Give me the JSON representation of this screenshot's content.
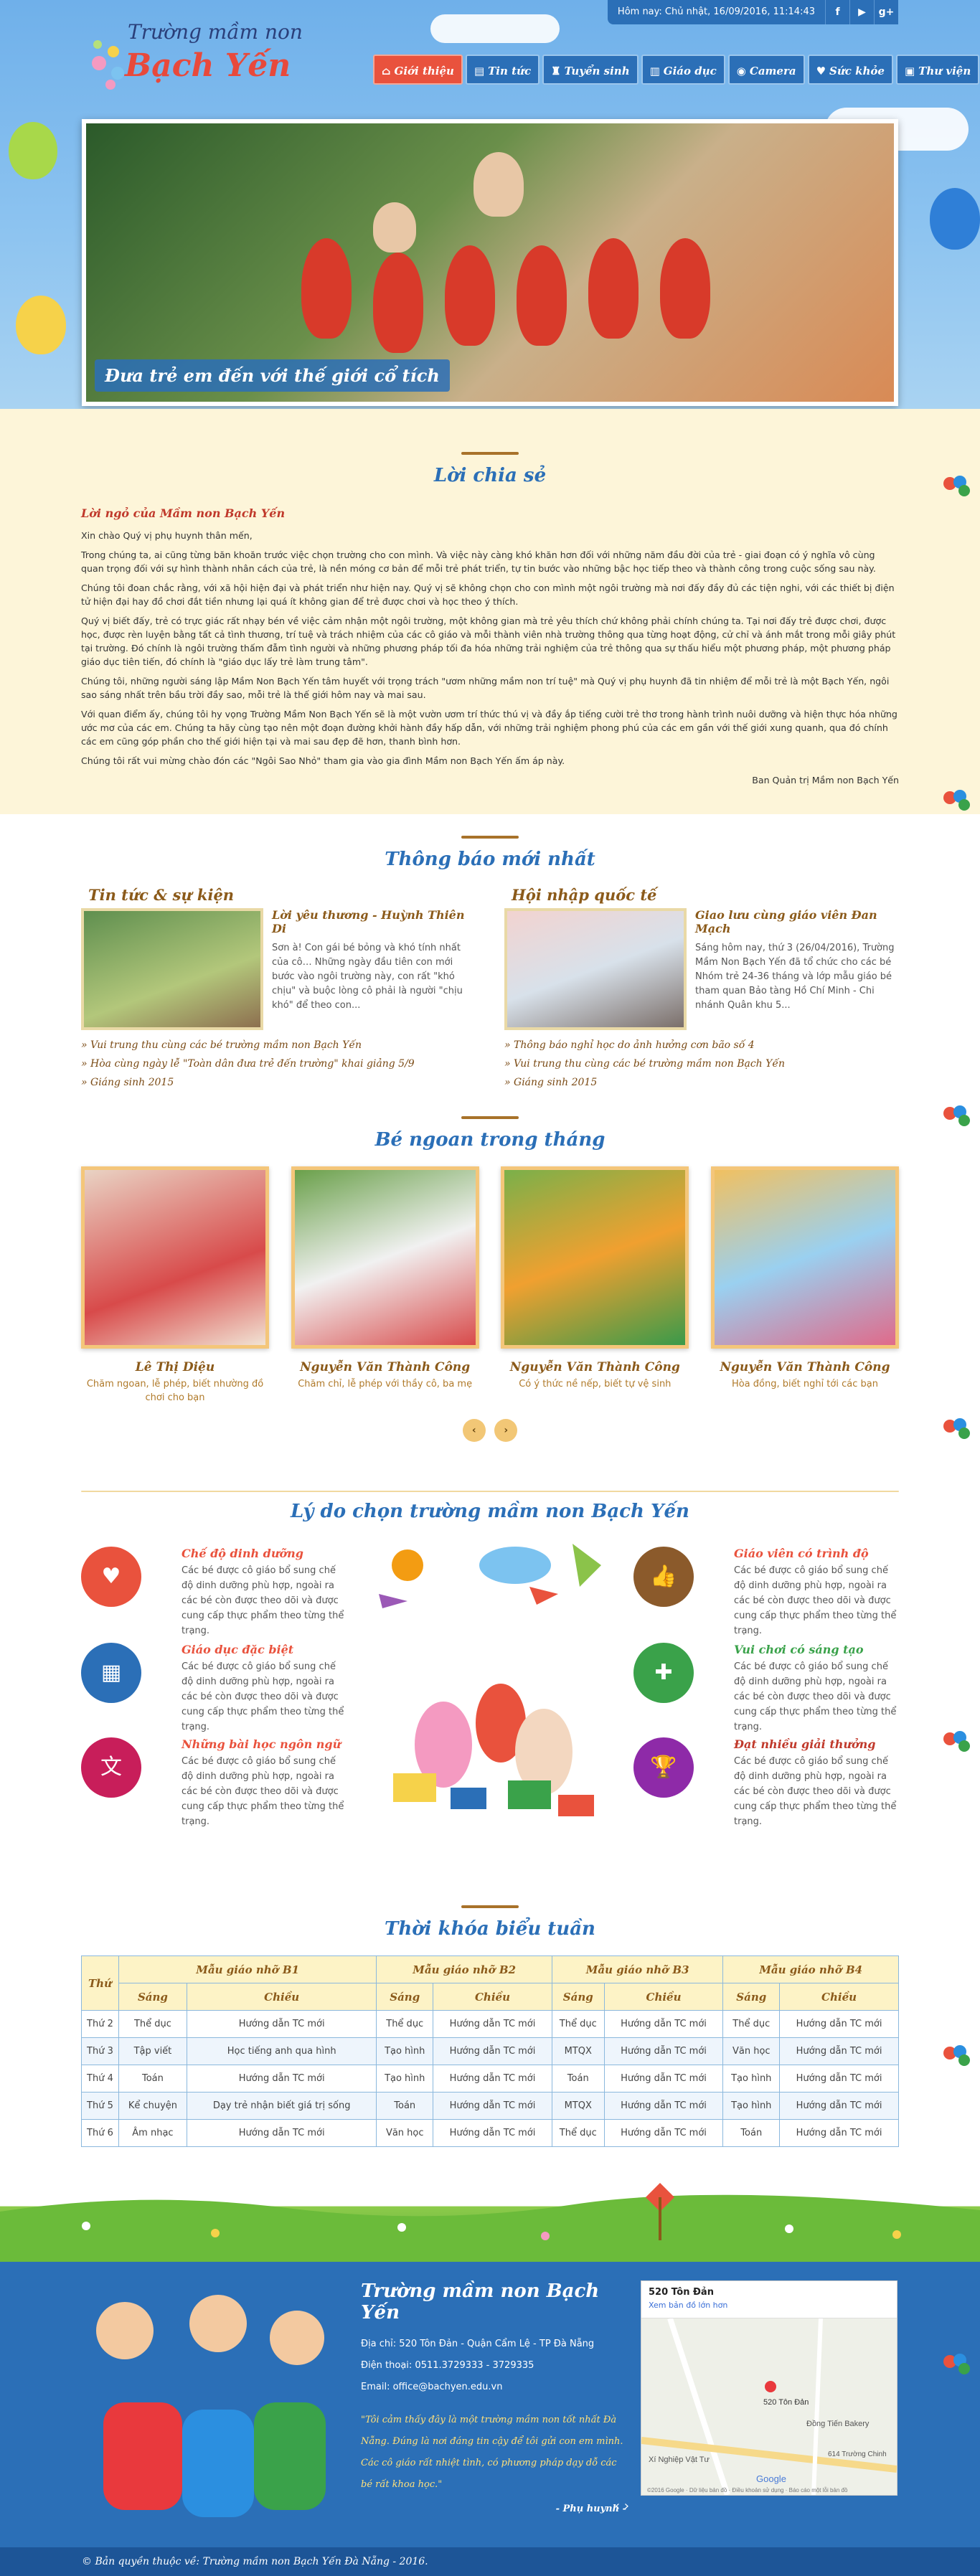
{
  "header": {
    "date_text": "Hôm nay: Chủ nhật, 16/09/2016, 11:14:43",
    "social": [
      "f",
      "▶",
      "g+"
    ],
    "logo_line1": "Trường mầm non",
    "logo_line2": "Bạch Yến",
    "nav": [
      {
        "label": "Giới thiệu",
        "icon": "home-icon",
        "glyph": "⌂"
      },
      {
        "label": "Tin tức",
        "icon": "news-icon",
        "glyph": "▤"
      },
      {
        "label": "Tuyển sinh",
        "icon": "graduation-icon",
        "glyph": "♜"
      },
      {
        "label": "Giáo dục",
        "icon": "book-icon",
        "glyph": "▥"
      },
      {
        "label": "Camera",
        "icon": "camera-icon",
        "glyph": "◉"
      },
      {
        "label": "Sức khỏe",
        "icon": "heart-icon",
        "glyph": "♥"
      },
      {
        "label": "Thư viện",
        "icon": "image-icon",
        "glyph": "▣"
      }
    ],
    "slider_caption": "Đưa trẻ em đến với thế giới cổ tích"
  },
  "about": {
    "title": "Lời chia sẻ",
    "lead": "Lời ngỏ của Mầm non Bạch Yến",
    "paragraphs": [
      "Xin chào Quý vị phụ huynh thân mến,",
      "Trong chúng ta, ai cũng từng băn khoăn trước việc chọn trường cho con mình. Và việc này càng khó khăn hơn đối với những năm đầu đời của trẻ - giai đoạn có ý nghĩa vô cùng quan trọng đối với sự hình thành nhân cách của trẻ, là nền móng cơ bản để mỗi trẻ phát triển, tự tin bước vào những bậc học tiếp theo và thành công trong cuộc sống sau này.",
      "Chúng tôi đoan chắc rằng, với xã hội hiện đại và phát triển như hiện nay. Quý vị sẽ không chọn cho con mình một ngôi trường mà nơi đấy đầy đủ các tiện nghi, với các thiết bị điện tử hiện đại hay đồ chơi đắt tiền nhưng lại quá ít không gian để trẻ được chơi và học theo ý thích.",
      "Quý vị biết đấy, trẻ có trực giác rất nhạy bén về việc cảm nhận một ngôi trường, một không gian mà trẻ yêu thích chứ không phải chính chúng ta. Tại nơi đấy trẻ được chơi, được học, được rèn luyện bằng tất cả tình thương, trí tuệ và trách nhiệm của các cô giáo và mỗi thành viên nhà trường thông qua từng hoạt động, cử chỉ và ánh mắt trong mỗi giây phút tại trường. Đó chính là ngôi trường thấm đẫm tình người và những phương pháp tối đa hóa những trải nghiệm của trẻ thông qua sự thấu hiểu một phương pháp, một phương pháp giáo dục tiên tiến, đó chính là \"giáo dục lấy trẻ làm trung tâm\".",
      "Chúng tôi, những người sáng lập Mầm Non Bạch Yến tâm huyết với trọng trách \"ươm những mầm non trí tuệ\" mà Quý vị phụ huynh đã tin nhiệm để mỗi trẻ là một Bạch Yến, ngôi sao sáng nhất trên bầu trời đầy sao, mỗi trẻ là thế giới hôm nay và mai sau.",
      "Với quan điểm ấy, chúng tôi hy vọng Trường Mầm Non Bạch Yến sẽ là một vườn ươm trí thức thú vị và đầy ắp tiếng cười trẻ thơ trong hành trình nuôi dưỡng và hiện thực hóa những ước mơ của các em. Chúng ta hãy cùng tạo nên một đoạn đường khởi hành đầy hấp dẫn, với những trải nghiệm phong phú của các em gần với thế giới xung quanh, qua đó chính các em cũng góp phần cho thế giới hiện tại và mai sau đẹp đẽ hơn, thanh bình hơn.",
      "Chúng tôi rất vui mừng chào đón các \"Ngôi Sao Nhỏ\" tham gia vào gia đình Mầm non Bạch Yến ấm áp này."
    ],
    "signature": "Ban Quản trị Mầm non Bạch Yến"
  },
  "news": {
    "title": "Thông báo mới nhất",
    "columns": [
      {
        "heading": "Tin tức & sự kiện",
        "item_title": "Lời yêu thương - Huỳnh Thiên Di",
        "item_desc": "Sơn à! Con gái bé bỏng và khó tính nhất của cô… Những ngày đầu tiên con mới bước vào ngôi trường này, con rất \"khó chịu\" và buộc lòng cô phải là người \"chịu khó\" để theo con...",
        "links": [
          "» Vui trung thu cùng các bé trường mầm non Bạch Yến",
          "» Hòa cùng ngày lễ \"Toàn dân đưa trẻ đến trường\" khai giảng 5/9",
          "» Giáng sinh 2015"
        ]
      },
      {
        "heading": "Hội nhập quốc tế",
        "item_title": "Giao lưu cùng giáo viên Đan Mạch",
        "item_desc": "Sáng hôm nay, thứ 3 (26/04/2016), Trường Mầm Non Bạch Yến đã tổ chức cho các bé Nhóm trẻ 24-36 tháng và lớp mẫu giáo bé tham quan Bảo tàng Hồ Chí Minh - Chi nhánh Quân khu 5...",
        "links": [
          "» Thông báo nghỉ học do ảnh hưởng cơn bão số 4",
          "» Vui trung thu cùng các bé trường mầm non Bạch Yến",
          "» Giáng sinh 2015"
        ]
      }
    ]
  },
  "kids": {
    "title": "Bé ngoan trong tháng",
    "cards": [
      {
        "name": "Lê Thị Diệu",
        "desc": "Chăm ngoan, lễ phép, biết nhường đồ chơi cho bạn"
      },
      {
        "name": "Nguyễn Văn Thành Công",
        "desc": "Chăm chỉ, lễ phép với thầy cô, ba mẹ"
      },
      {
        "name": "Nguyễn Văn Thành Công",
        "desc": "Có ý thức nề nếp, biết tự vệ sinh"
      },
      {
        "name": "Nguyễn Văn Thành Công",
        "desc": "Hòa đồng, biết nghỉ tới các bạn"
      }
    ],
    "prev": "‹",
    "next": "›"
  },
  "reasons": {
    "title": "Lý do chọn trường mầm non Bạch Yến",
    "desc": "Các bé được cô giáo bổ sung chế độ dinh dưỡng phù hợp, ngoài ra các bé còn được theo dõi và được cung cấp thực phẩm theo từng thể trạng.",
    "left": [
      {
        "title": "Chế độ dinh dưỡng",
        "icon": "heart-icon",
        "glyph": "♥",
        "color": "#e9523d"
      },
      {
        "title": "Giáo dục đặc biệt",
        "icon": "calendar-icon",
        "glyph": "▦",
        "color": "#2b6fb7"
      },
      {
        "title": "Những bài học ngôn ngữ",
        "icon": "translate-icon",
        "glyph": "文",
        "color": "#c81e5a"
      }
    ],
    "right": [
      {
        "title": "Giáo viên có trình độ",
        "icon": "thumbs-up-icon",
        "glyph": "👍",
        "color": "#8b5a2b"
      },
      {
        "title": "Vui chơi có sáng tạo",
        "icon": "gamepad-icon",
        "glyph": "✚",
        "color": "#3aa24a"
      },
      {
        "title": "Đạt nhiều giải thưởng",
        "icon": "trophy-icon",
        "glyph": "🏆",
        "color": "#8e2aa8"
      }
    ]
  },
  "timetable": {
    "title": "Thời khóa biểu tuần",
    "corner": "Thứ",
    "classes": [
      "Mẫu giáo nhỡ B1",
      "Mẫu giáo nhỡ B2",
      "Mẫu giáo nhỡ B3",
      "Mẫu giáo nhỡ B4"
    ],
    "sub": [
      "Sáng",
      "Chiều"
    ],
    "rows": [
      [
        "Thứ 2",
        "Thể dục",
        "Hướng dẫn TC mới",
        "Thể dục",
        "Hướng dẫn TC mới",
        "Thể dục",
        "Hướng dẫn TC mới",
        "Thể dục",
        "Hướng dẫn TC mới"
      ],
      [
        "Thứ 3",
        "Tập viết",
        "Học tiếng anh qua hình",
        "Tạo hình",
        "Hướng dẫn TC mới",
        "MTQX",
        "Hướng dẫn TC mới",
        "Văn học",
        "Hướng dẫn TC mới"
      ],
      [
        "Thứ 4",
        "Toán",
        "Hướng dẫn TC mới",
        "Tạo hình",
        "Hướng dẫn TC mới",
        "Toán",
        "Hướng dẫn TC mới",
        "Tạo hình",
        "Hướng dẫn TC mới"
      ],
      [
        "Thứ 5",
        "Kể chuyện",
        "Dạy trẻ nhận biết giá trị sống",
        "Toán",
        "Hướng dẫn TC mới",
        "MTQX",
        "Hướng dẫn TC mới",
        "Tạo hình",
        "Hướng dẫn TC mới"
      ],
      [
        "Thứ 6",
        "Âm nhạc",
        "Hướng dẫn TC mới",
        "Văn học",
        "Hướng dẫn TC mới",
        "Thể dục",
        "Hướng dẫn TC mới",
        "Toán",
        "Hướng dẫn TC mới"
      ]
    ]
  },
  "footer": {
    "school": "Trường mầm non Bạch Yến",
    "address": "Địa chỉ: 520 Tôn Đản - Quận Cẩm Lệ - TP Đà Nẵng",
    "phone": "Điện thoại: 0511.3729333 - 3729335",
    "email": "Email: office@bachyen.edu.vn",
    "quote": "\"Tôi cảm thấy đây là một trường mầm non tốt nhất Đà Nẵng. Đúng là nơi đáng tin cậy để tôi gửi con em mình. Các cô giáo rất nhiệt tình, có phương pháp dạy dỗ các bé rất khoa học.\"",
    "quote_author": "- Phụ huynh -",
    "map_title": "520 Tôn Đản",
    "map_link": "Xem bản đồ lớn hơn",
    "map_pin": "520 Tôn Đản",
    "map_labels": [
      "Đồng Tiến Bakery",
      "614 Trường Chinh",
      "Xí Nghiệp Vật Tư",
      "Google"
    ],
    "map_footer": "©2016 Google · Dữ liệu bản đồ · Điều khoản sử dụng · Báo cáo một lỗi bản đồ",
    "map_nav": "‹ ›",
    "copyright": "© Bản quyền thuộc về: Trường mầm non Bạch Yến Đà Nẵng - 2016."
  },
  "colors": {
    "brand_blue": "#2b6fb7",
    "accent_red": "#e9523d",
    "cream": "#fdf5d9",
    "brown": "#8b5a1a"
  }
}
